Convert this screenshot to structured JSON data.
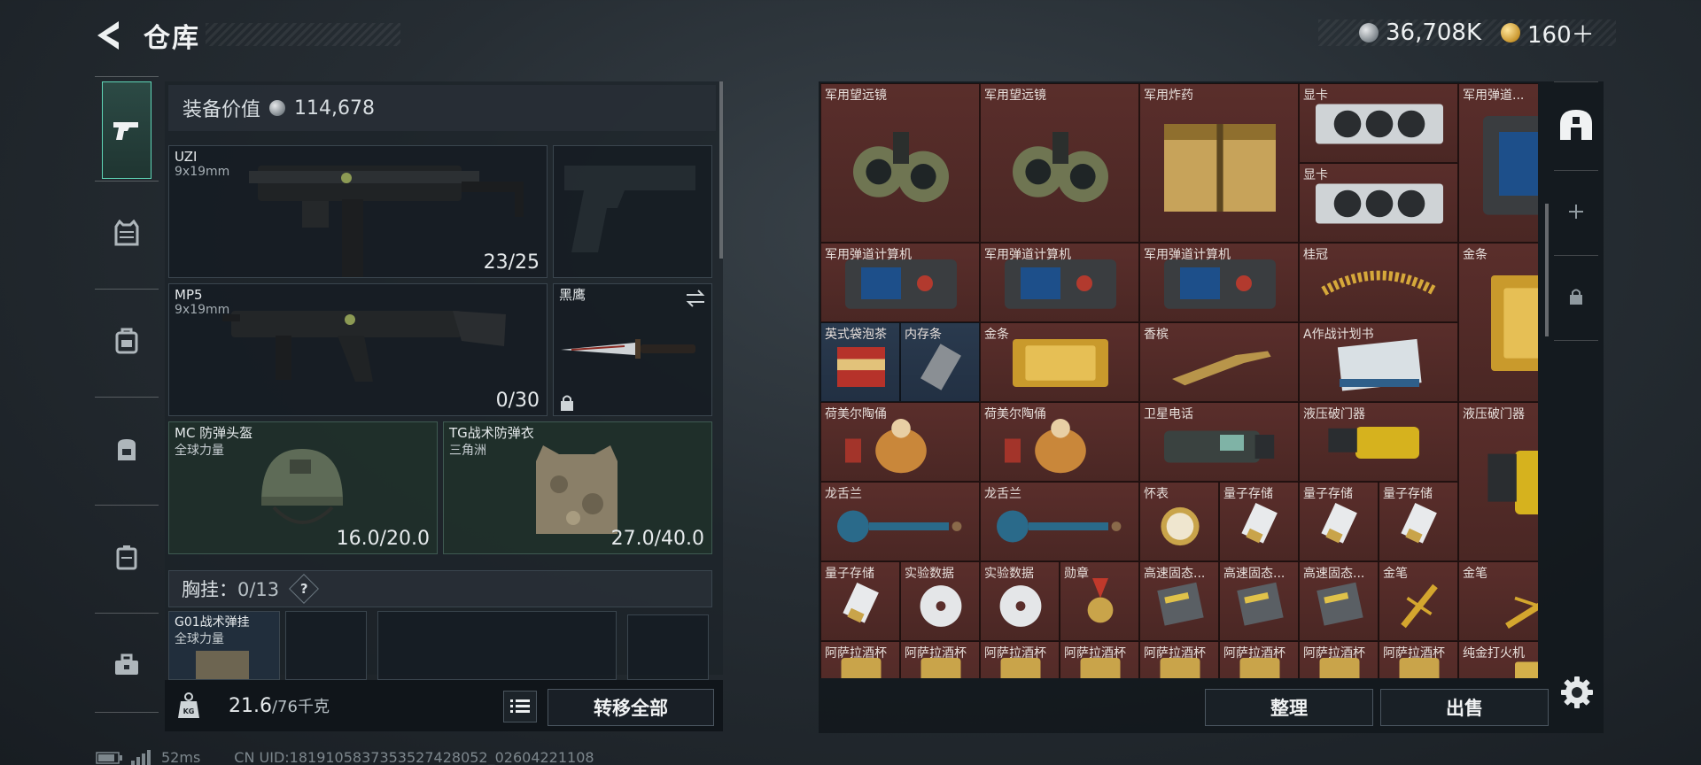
{
  "header": {
    "title": "仓库",
    "silver_amount": "36,708K",
    "gold_amount": "160＋"
  },
  "loadout": {
    "equipment_value_label": "装备价值",
    "equipment_value": "114,678",
    "primary_weapon": {
      "name": "UZI",
      "caliber": "9x19mm",
      "ammo": "23/25"
    },
    "secondary_weapon": {
      "name": "MP5",
      "caliber": "9x19mm",
      "ammo": "0/30"
    },
    "melee": {
      "name": "黑鹰"
    },
    "helmet": {
      "name": "MC 防弹头盔",
      "sub": "全球力量",
      "durability": "16.0/20.0"
    },
    "armor": {
      "name": "TG战术防弹衣",
      "sub": "三角洲",
      "durability": "27.0/40.0"
    },
    "chest_rig_label": "胸挂：",
    "chest_rig_capacity": "0/13",
    "help": "?",
    "chest_rig_item": {
      "name": "G01战术弹挂",
      "sub": "全球力量"
    },
    "weight_value": "21.6",
    "weight_unit": "/76千克",
    "weight_badge": "KG",
    "transfer_all": "转移全部"
  },
  "actions": {
    "sort": "整理",
    "sell": "出售"
  },
  "status": {
    "ping": "52ms",
    "uid": "CN UID:1819105837353527428052_02604221108"
  },
  "items": [
    {
      "name": "军用望远镜",
      "c": 0,
      "r": 0,
      "w": 1,
      "h": 2,
      "bg": "red",
      "icon": "binoculars"
    },
    {
      "name": "军用望远镜",
      "c": 1,
      "r": 0,
      "w": 1,
      "h": 2,
      "bg": "red",
      "icon": "binoculars"
    },
    {
      "name": "军用炸药",
      "c": 2,
      "r": 0,
      "w": 1,
      "h": 2,
      "bg": "red",
      "icon": "explosive"
    },
    {
      "name": "显卡",
      "c": 3,
      "r": 0,
      "w": 1,
      "h": 1,
      "bg": "red",
      "icon": "gpu"
    },
    {
      "name": "显卡",
      "c": 3,
      "r": 1,
      "w": 1,
      "h": 1,
      "bg": "red",
      "icon": "gpu"
    },
    {
      "name": "军用弹道...",
      "c": 4,
      "r": 0,
      "w": 1,
      "h": 2,
      "bg": "red",
      "icon": "calculator"
    },
    {
      "name": "军用弹道计算机",
      "c": 0,
      "r": 2,
      "w": 1,
      "h": 1,
      "bg": "red",
      "icon": "calculator"
    },
    {
      "name": "军用弹道计算机",
      "c": 1,
      "r": 2,
      "w": 1,
      "h": 1,
      "bg": "red",
      "icon": "calculator"
    },
    {
      "name": "军用弹道计算机",
      "c": 2,
      "r": 2,
      "w": 1,
      "h": 1,
      "bg": "red",
      "icon": "calculator"
    },
    {
      "name": "桂冠",
      "c": 3,
      "r": 2,
      "w": 1,
      "h": 1,
      "bg": "red",
      "icon": "laurel"
    },
    {
      "name": "金条",
      "c": 4,
      "r": 2,
      "w": 1,
      "h": 2,
      "bg": "red",
      "icon": "goldbar"
    },
    {
      "name": "英式袋泡茶",
      "c": 0,
      "r": 3,
      "w": 0.5,
      "h": 1,
      "bg": "blue",
      "icon": "tea"
    },
    {
      "name": "内存条",
      "c": 0.5,
      "r": 3,
      "w": 0.5,
      "h": 1,
      "bg": "blue",
      "icon": "ram"
    },
    {
      "name": "金条",
      "c": 1,
      "r": 3,
      "w": 1,
      "h": 1,
      "bg": "red",
      "icon": "goldbar"
    },
    {
      "name": "香槟",
      "c": 2,
      "r": 3,
      "w": 1,
      "h": 1,
      "bg": "red",
      "icon": "champagne"
    },
    {
      "name": "A作战计划书",
      "c": 3,
      "r": 3,
      "w": 1,
      "h": 1,
      "bg": "red",
      "icon": "book"
    },
    {
      "name": "荷美尔陶俑",
      "c": 0,
      "r": 4,
      "w": 1,
      "h": 1,
      "bg": "red",
      "icon": "figurine"
    },
    {
      "name": "荷美尔陶俑",
      "c": 1,
      "r": 4,
      "w": 1,
      "h": 1,
      "bg": "red",
      "icon": "figurine"
    },
    {
      "name": "卫星电话",
      "c": 2,
      "r": 4,
      "w": 1,
      "h": 1,
      "bg": "red",
      "icon": "satphone"
    },
    {
      "name": "液压破门器",
      "c": 3,
      "r": 4,
      "w": 1,
      "h": 1,
      "bg": "red",
      "icon": "breacher"
    },
    {
      "name": "液压破门器",
      "c": 4,
      "r": 4,
      "w": 1,
      "h": 2,
      "bg": "red",
      "icon": "breacher"
    },
    {
      "name": "龙舌兰",
      "c": 0,
      "r": 5,
      "w": 1,
      "h": 1,
      "bg": "red",
      "icon": "tequila"
    },
    {
      "name": "龙舌兰",
      "c": 1,
      "r": 5,
      "w": 1,
      "h": 1,
      "bg": "red",
      "icon": "tequila"
    },
    {
      "name": "怀表",
      "c": 2,
      "r": 5,
      "w": 0.5,
      "h": 1,
      "bg": "red",
      "icon": "watch"
    },
    {
      "name": "量子存储",
      "c": 2.5,
      "r": 5,
      "w": 0.5,
      "h": 1,
      "bg": "red",
      "icon": "usb"
    },
    {
      "name": "量子存储",
      "c": 3,
      "r": 5,
      "w": 0.5,
      "h": 1,
      "bg": "red",
      "icon": "usb"
    },
    {
      "name": "量子存储",
      "c": 3.5,
      "r": 5,
      "w": 0.5,
      "h": 1,
      "bg": "red",
      "icon": "usb"
    },
    {
      "name": "量子存储",
      "c": 0,
      "r": 6,
      "w": 0.5,
      "h": 1,
      "bg": "red",
      "icon": "usb"
    },
    {
      "name": "实验数据",
      "c": 0.5,
      "r": 6,
      "w": 0.5,
      "h": 1,
      "bg": "red",
      "icon": "disc"
    },
    {
      "name": "实验数据",
      "c": 1,
      "r": 6,
      "w": 0.5,
      "h": 1,
      "bg": "red",
      "icon": "disc"
    },
    {
      "name": "勋章",
      "c": 1.5,
      "r": 6,
      "w": 0.5,
      "h": 1,
      "bg": "red",
      "icon": "medal"
    },
    {
      "name": "高速固态...",
      "c": 2,
      "r": 6,
      "w": 0.5,
      "h": 1,
      "bg": "red",
      "icon": "ssd"
    },
    {
      "name": "高速固态...",
      "c": 2.5,
      "r": 6,
      "w": 0.5,
      "h": 1,
      "bg": "red",
      "icon": "ssd"
    },
    {
      "name": "高速固态...",
      "c": 3,
      "r": 6,
      "w": 0.5,
      "h": 1,
      "bg": "red",
      "icon": "ssd"
    },
    {
      "name": "金笔",
      "c": 3.5,
      "r": 6,
      "w": 0.5,
      "h": 1,
      "bg": "red",
      "icon": "pen"
    },
    {
      "name": "金笔",
      "c": 4,
      "r": 6,
      "w": 1,
      "h": 1,
      "bg": "red",
      "icon": "pen"
    },
    {
      "name": "阿萨拉酒杯",
      "c": 0,
      "r": 7,
      "w": 0.5,
      "h": 1,
      "bg": "red",
      "icon": "cup"
    },
    {
      "name": "阿萨拉酒杯",
      "c": 0.5,
      "r": 7,
      "w": 0.5,
      "h": 1,
      "bg": "red",
      "icon": "cup"
    },
    {
      "name": "阿萨拉酒杯",
      "c": 1,
      "r": 7,
      "w": 0.5,
      "h": 1,
      "bg": "red",
      "icon": "cup"
    },
    {
      "name": "阿萨拉酒杯",
      "c": 1.5,
      "r": 7,
      "w": 0.5,
      "h": 1,
      "bg": "red",
      "icon": "cup"
    },
    {
      "name": "阿萨拉酒杯",
      "c": 2,
      "r": 7,
      "w": 0.5,
      "h": 1,
      "bg": "red",
      "icon": "cup"
    },
    {
      "name": "阿萨拉酒杯",
      "c": 2.5,
      "r": 7,
      "w": 0.5,
      "h": 1,
      "bg": "red",
      "icon": "cup"
    },
    {
      "name": "阿萨拉酒杯",
      "c": 3,
      "r": 7,
      "w": 0.5,
      "h": 1,
      "bg": "red",
      "icon": "cup"
    },
    {
      "name": "阿萨拉酒杯",
      "c": 3.5,
      "r": 7,
      "w": 0.5,
      "h": 1,
      "bg": "red",
      "icon": "cup"
    },
    {
      "name": "纯金打火机",
      "c": 4,
      "r": 7,
      "w": 1,
      "h": 1,
      "bg": "red",
      "icon": "lighter"
    }
  ]
}
